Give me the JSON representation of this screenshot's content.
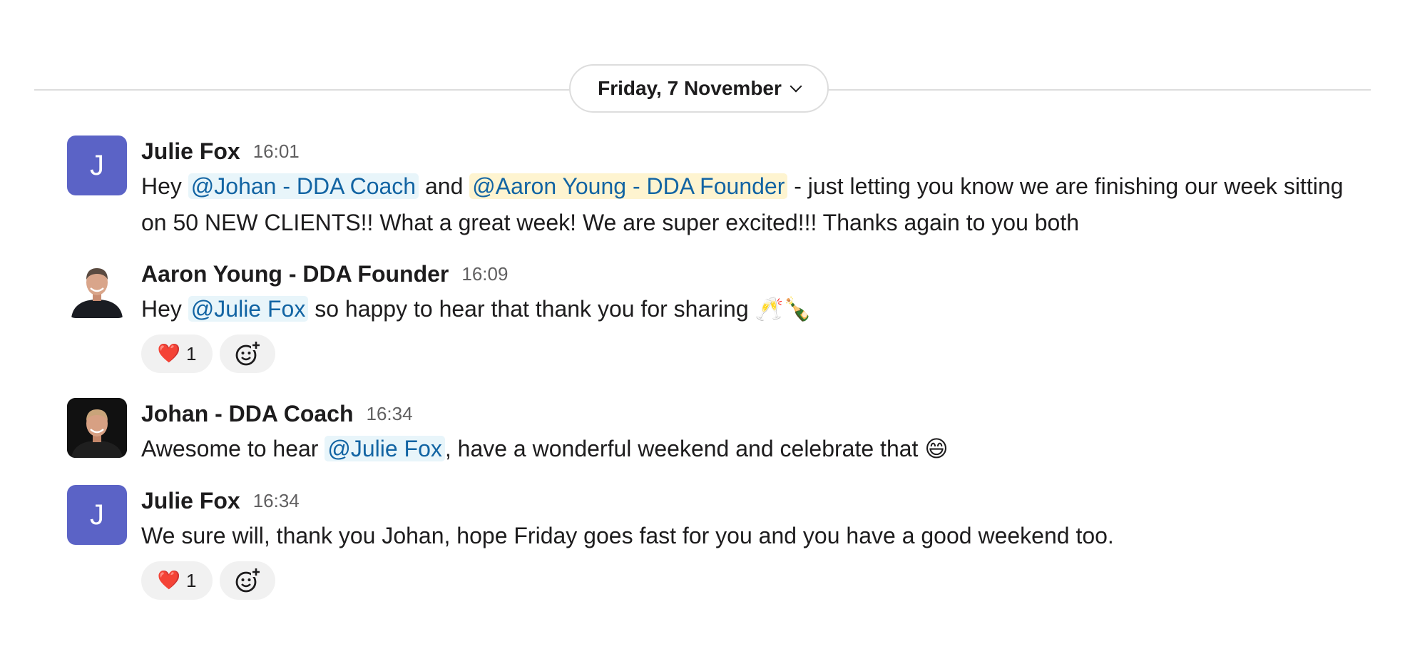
{
  "date_divider": {
    "label": "Friday, 7 November"
  },
  "messages": [
    {
      "author": "Julie Fox",
      "time": "16:01",
      "avatar_letter": "J",
      "text_1": "Hey ",
      "mention_1": "@Johan - DDA Coach",
      "text_2": " and ",
      "mention_2": "@Aaron Young - DDA Founder",
      "text_3": " - just letting you know we are finishing our week sitting on 50 NEW CLIENTS!!  What a great week!  We are super excited!!! Thanks again to you both"
    },
    {
      "author": "Aaron Young - DDA Founder",
      "time": "16:09",
      "text_1": "Hey ",
      "mention_1": "@Julie Fox",
      "text_2": " so happy to hear that thank you for sharing ",
      "emoji_1": "clinking-glasses",
      "emoji_2": "champagne-bottle",
      "reaction": {
        "emoji": "red-heart",
        "count": "1"
      }
    },
    {
      "author": "Johan - DDA Coach",
      "time": "16:34",
      "text_1": "Awesome to hear ",
      "mention_1": "@Julie Fox",
      "text_2": ", have a wonderful weekend and celebrate that ",
      "emoji_1": "grinning-face"
    },
    {
      "author": "Julie Fox",
      "time": "16:34",
      "avatar_letter": "J",
      "text_1": "We sure will, thank you Johan, hope Friday goes fast for you and you have a good weekend too.",
      "reaction": {
        "emoji": "red-heart",
        "count": "1"
      }
    }
  ],
  "colors": {
    "avatar_bg": "#5b63c6",
    "mention_text": "#1264a3",
    "mention_bg": "#e8f5fa",
    "self_mention_bg": "#fef4d0",
    "reaction_bg": "#f1f1f1"
  }
}
